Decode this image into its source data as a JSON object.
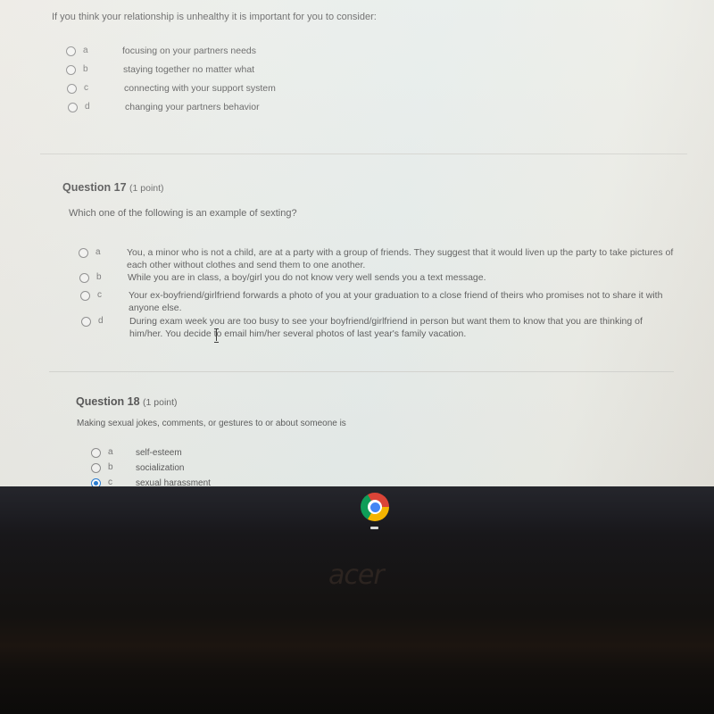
{
  "question16": {
    "prompt": "If you think your relationship is unhealthy it is important for you to consider:",
    "options": [
      {
        "letter": "a",
        "text": "focusing on your partners needs",
        "selected": false
      },
      {
        "letter": "b",
        "text": "staying together no matter what",
        "selected": false
      },
      {
        "letter": "c",
        "text": "connecting with your support system",
        "selected": false
      },
      {
        "letter": "d",
        "text": "changing your partners behavior",
        "selected": false
      }
    ]
  },
  "question17": {
    "title": "Question 17",
    "points": "(1 point)",
    "prompt": "Which one of the following is an example of sexting?",
    "options": [
      {
        "letter": "a",
        "text": "You, a minor who is not a child, are at a party with a group of friends. They suggest that it would liven up the party to take pictures of each other without clothes and send them to one another.",
        "selected": false
      },
      {
        "letter": "b",
        "text": "While you are in class, a boy/girl you do not know very well sends you a text message.",
        "selected": false
      },
      {
        "letter": "c",
        "text": "Your ex-boyfriend/girlfriend forwards a photo of you at your graduation to a close friend of theirs who promises not to share it with anyone else.",
        "selected": false
      },
      {
        "letter": "d",
        "text": "During exam week you are too busy to see your boyfriend/girlfriend in person but want them to know that you are thinking of him/her. You decide to email him/her several photos of last year's family vacation.",
        "selected": false
      }
    ]
  },
  "question18": {
    "title": "Question 18",
    "points": "(1 point)",
    "prompt": "Making sexual jokes, comments, or gestures to or about someone is",
    "options": [
      {
        "letter": "a",
        "text": "self-esteem",
        "selected": false
      },
      {
        "letter": "b",
        "text": "socialization",
        "selected": false
      },
      {
        "letter": "c",
        "text": "sexual harassment",
        "selected": true
      }
    ]
  },
  "shelf": {
    "apps": [
      {
        "name": "Chrome",
        "icon": "chrome-icon",
        "active": true
      }
    ]
  },
  "device": {
    "brand": "acer"
  },
  "colors": {
    "radio_selected": "#2b7fd6",
    "text": "#5a5a5a"
  }
}
